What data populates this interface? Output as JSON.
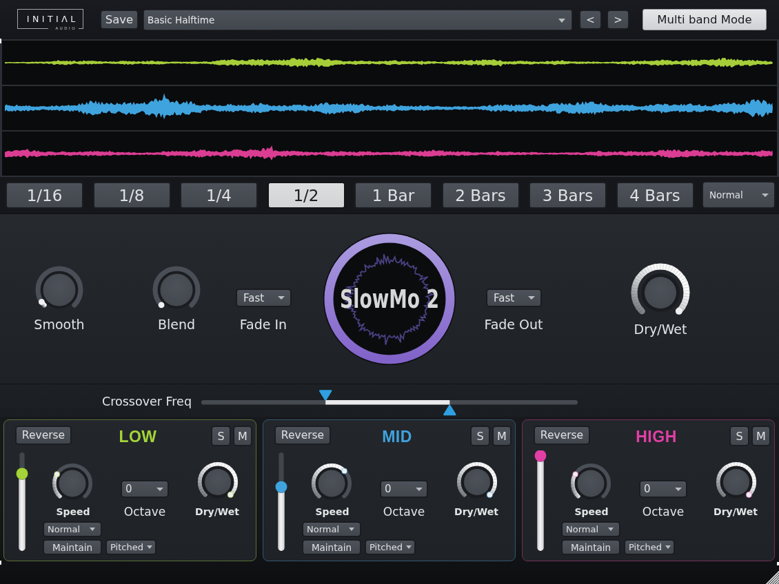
{
  "topbar": {
    "logo_text": "INITIΛL",
    "logo_sub": "AUDIO",
    "save_label": "Save",
    "preset_value": "Basic Halftime",
    "prev_label": "<",
    "next_label": ">",
    "multiband_label": "Multi band Mode"
  },
  "waveform": {
    "rows": [
      {
        "name": "low-band-waveform",
        "color": "#a6ce39",
        "amp": 8,
        "base": 1.0,
        "seed": 41
      },
      {
        "name": "mid-band-waveform",
        "color": "#3fa3dd",
        "amp": 16,
        "base": 2.6,
        "seed": 97
      },
      {
        "name": "high-band-waveform",
        "color": "#da3d92",
        "amp": 9,
        "base": 1.7,
        "seed": 23
      }
    ]
  },
  "divisions": {
    "buttons": [
      {
        "label": "1/16",
        "selected": false
      },
      {
        "label": "1/8",
        "selected": false
      },
      {
        "label": "1/4",
        "selected": false
      },
      {
        "label": "1/2",
        "selected": true
      },
      {
        "label": "1 Bar",
        "selected": false
      },
      {
        "label": "2 Bars",
        "selected": false
      },
      {
        "label": "3 Bars",
        "selected": false
      },
      {
        "label": "4 Bars",
        "selected": false
      }
    ],
    "mode_value": "Normal"
  },
  "main": {
    "smooth": {
      "label": "Smooth",
      "value": 0.04
    },
    "blend": {
      "label": "Blend",
      "value": 0.0
    },
    "fade_in": {
      "label": "Fade In",
      "value": "Fast"
    },
    "fade_out": {
      "label": "Fade Out",
      "value": "Fast"
    },
    "dry_wet": {
      "label": "Dry/Wet",
      "value": 1.0
    },
    "logo_text": "SlowMo 2",
    "logo_ring_color": "#8f76d2"
  },
  "crossover": {
    "label": "Crossover Freq",
    "low_handle": 0.33,
    "high_handle": 0.66,
    "handle_color": "#2f9fe0"
  },
  "bands": [
    {
      "name": "LOW",
      "accent": "#a3d438",
      "border": "#5c7036",
      "reverse_label": "Reverse",
      "solo_label": "S",
      "mute_label": "M",
      "slider_value": 0.21,
      "speed": {
        "label": "Speed",
        "value": 0.28
      },
      "octave": {
        "label": "Octave",
        "value": "0"
      },
      "dry_wet": {
        "label": "Dry/Wet",
        "value": 1.0
      },
      "mode_value": "Normal",
      "maintain_label": "Maintain",
      "pitch_value": "Pitched"
    },
    {
      "name": "MID",
      "accent": "#3fa3dd",
      "border": "#32576f",
      "reverse_label": "Reverse",
      "solo_label": "S",
      "mute_label": "M",
      "slider_value": 0.35,
      "speed": {
        "label": "Speed",
        "value": 0.67
      },
      "octave": {
        "label": "Octave",
        "value": "0"
      },
      "dry_wet": {
        "label": "Dry/Wet",
        "value": 1.0
      },
      "mode_value": "Normal",
      "maintain_label": "Maintain",
      "pitch_value": "Pitched"
    },
    {
      "name": "HIGH",
      "accent": "#e13fa5",
      "border": "#713058",
      "reverse_label": "Reverse",
      "solo_label": "S",
      "mute_label": "M",
      "slider_value": 0.02,
      "speed": {
        "label": "Speed",
        "value": 0.28
      },
      "octave": {
        "label": "Octave",
        "value": "0"
      },
      "dry_wet": {
        "label": "Dry/Wet",
        "value": 1.0
      },
      "mode_value": "Normal",
      "maintain_label": "Maintain",
      "pitch_value": "Pitched"
    }
  ]
}
